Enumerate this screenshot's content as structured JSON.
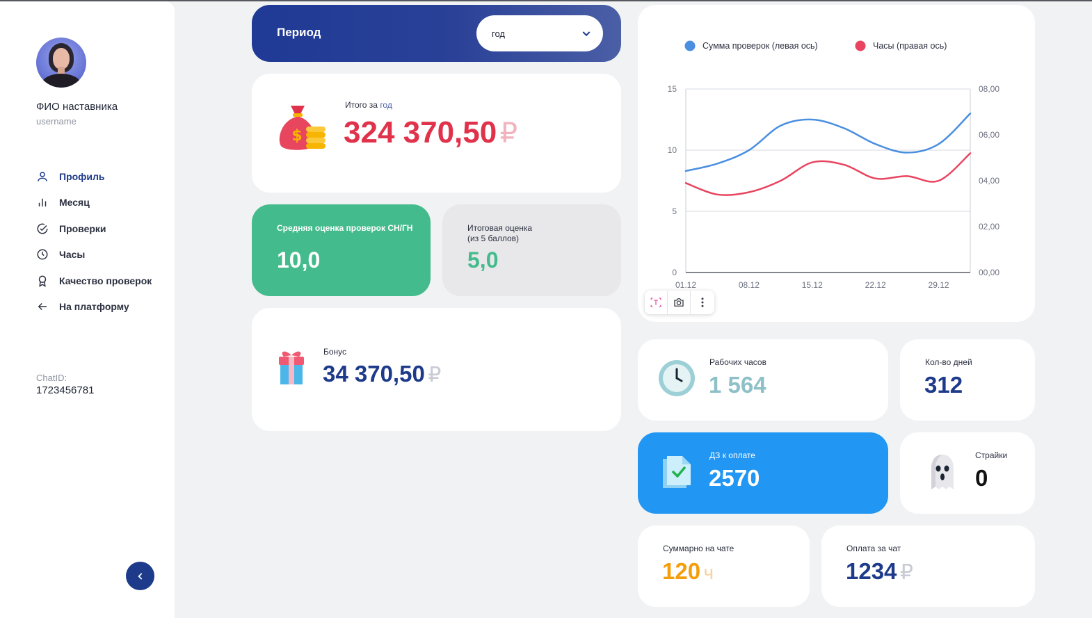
{
  "sidebar": {
    "mentor_name": "ФИО наставника",
    "username": "username",
    "nav": [
      {
        "label": "Профиль",
        "icon": "user-icon"
      },
      {
        "label": "Месяц",
        "icon": "bar-chart-icon"
      },
      {
        "label": "Проверки",
        "icon": "check-circle-icon"
      },
      {
        "label": "Часы",
        "icon": "clock-icon"
      },
      {
        "label": "Качество проверок",
        "icon": "award-icon"
      },
      {
        "label": "На платформу",
        "icon": "arrow-left-icon"
      }
    ],
    "chat_label": "ChatID:",
    "chat_id": "1723456781"
  },
  "period": {
    "label": "Период",
    "selected": "год"
  },
  "total": {
    "label_prefix": "Итого за",
    "label_period": "год",
    "value": "324 370,50",
    "currency": "₽"
  },
  "avg_score": {
    "label": "Средняя оценка проверок СН/ГН",
    "value": "10,0"
  },
  "final_score": {
    "label_line1": "Итоговая оценка",
    "label_line2": "(из 5 баллов)",
    "value": "5,0"
  },
  "bonus": {
    "label": "Бонус",
    "value": "34 370,50",
    "currency": "₽"
  },
  "work_hours": {
    "label": "Рабочих часов",
    "value": "1 564"
  },
  "days": {
    "label": "Кол-во дней",
    "value": "312"
  },
  "hw_to_pay": {
    "label": "ДЗ к оплате",
    "value": "2570"
  },
  "strikes": {
    "label": "Страйки",
    "value": "0"
  },
  "chat_total": {
    "label": "Суммарно на чате",
    "value": "120",
    "unit": "ч"
  },
  "chat_payment": {
    "label": "Оплата за чат",
    "value": "1234",
    "currency": "₽"
  },
  "colors": {
    "brand": "#1e3a8a",
    "red": "#e0334b",
    "green": "#44bb8c",
    "blue_card": "#2196f3",
    "orange": "#f59e0b",
    "series_blue": "#4a8fe0",
    "series_red": "#e8445f"
  },
  "chart_data": {
    "type": "line",
    "x": [
      "01.12",
      "04.12",
      "08.12",
      "11.12",
      "15.12",
      "18.12",
      "22.12",
      "25.12",
      "29.12",
      "01.01"
    ],
    "x_ticks": [
      "01.12",
      "08.12",
      "15.12",
      "22.12",
      "29.12"
    ],
    "y_left_ticks": [
      "0",
      "5",
      "10",
      "15"
    ],
    "y_right_ticks": [
      "00,00",
      "02,00",
      "04,00",
      "06,00",
      "08,00"
    ],
    "ylim_left": [
      0,
      15
    ],
    "ylim_right": [
      0,
      8
    ],
    "series": [
      {
        "name": "Сумма проверок (левая ось)",
        "axis": "left",
        "color": "#4a8fe0",
        "values": [
          8.3,
          8.9,
          10.0,
          12.0,
          12.5,
          11.8,
          10.5,
          9.8,
          10.5,
          13.0
        ]
      },
      {
        "name": "Часы (правая ось)",
        "axis": "right",
        "color": "#e8445f",
        "values": [
          3.9,
          3.4,
          3.5,
          4.0,
          4.8,
          4.7,
          4.1,
          4.2,
          4.0,
          5.2
        ]
      }
    ],
    "grid": "horizontal",
    "legend": "top"
  }
}
